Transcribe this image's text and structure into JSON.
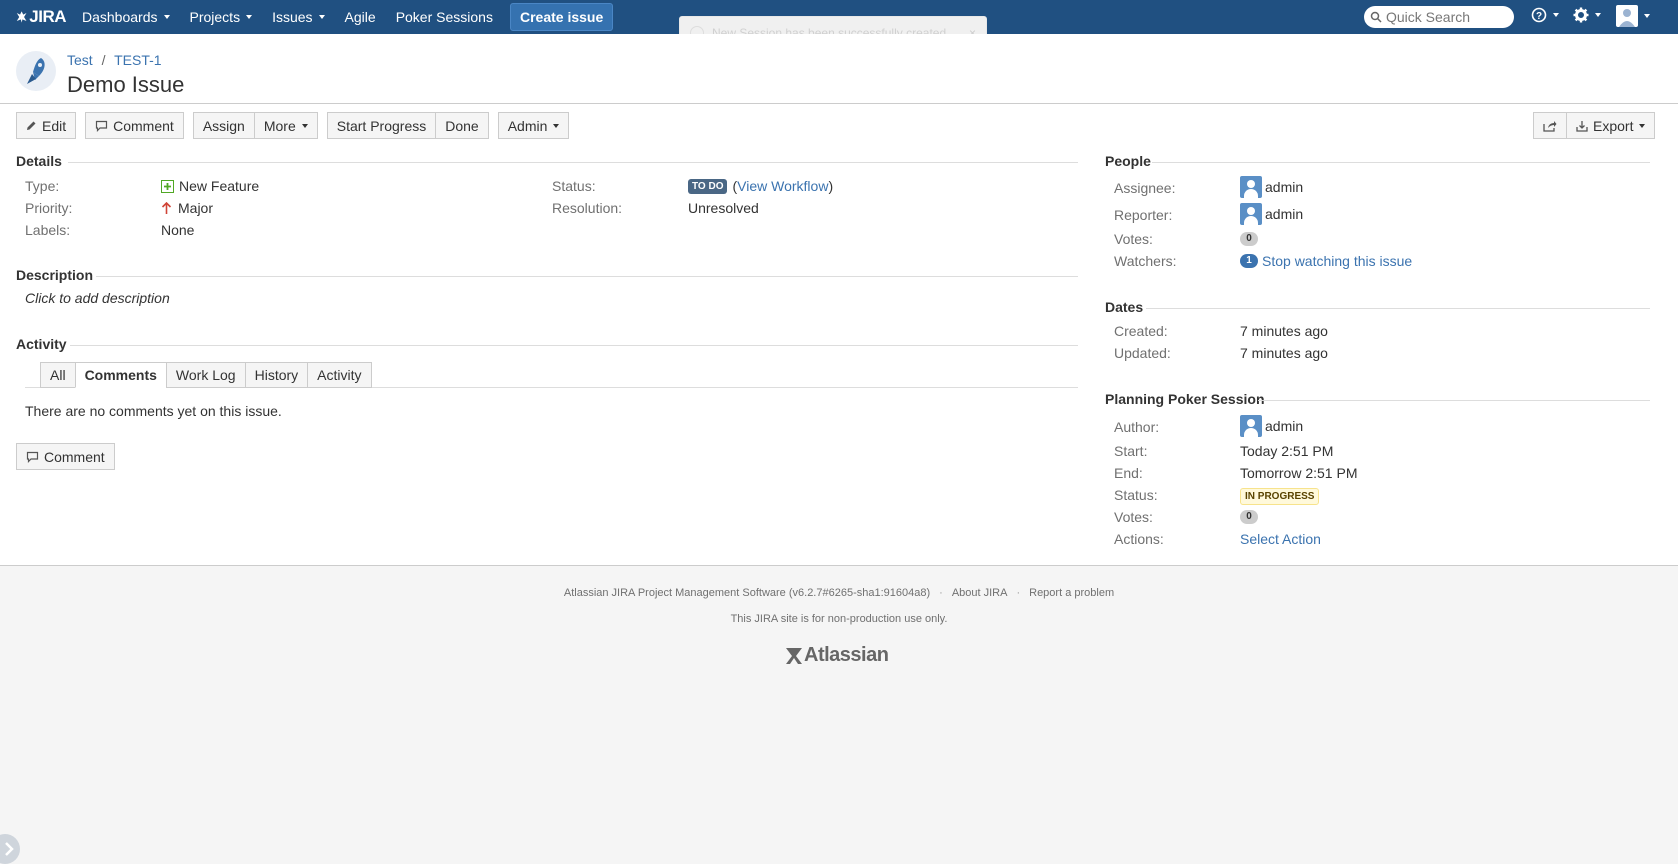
{
  "header": {
    "logo_text": "JIRA",
    "nav": [
      {
        "label": "Dashboards",
        "dropdown": true
      },
      {
        "label": "Projects",
        "dropdown": true
      },
      {
        "label": "Issues",
        "dropdown": true
      },
      {
        "label": "Agile",
        "dropdown": false
      },
      {
        "label": "Poker Sessions",
        "dropdown": false
      }
    ],
    "create_label": "Create issue",
    "search_placeholder": "Quick Search",
    "icons": [
      "help-icon",
      "gear-icon",
      "user-icon"
    ]
  },
  "toast": {
    "message": "New Session has been successfully created.",
    "close": "×"
  },
  "issue": {
    "project": "Test",
    "key": "TEST-1",
    "separator": "/",
    "title": "Demo Issue"
  },
  "toolbar": {
    "edit": "Edit",
    "comment": "Comment",
    "assign": "Assign",
    "more": "More",
    "start_progress": "Start Progress",
    "done": "Done",
    "admin": "Admin",
    "export": "Export"
  },
  "details": {
    "title": "Details",
    "type_label": "Type:",
    "type_value": "New Feature",
    "priority_label": "Priority:",
    "priority_value": "Major",
    "labels_label": "Labels:",
    "labels_value": "None",
    "status_label": "Status:",
    "status_value": "TO DO",
    "view_workflow": "View Workflow",
    "paren_open": "(",
    "paren_close": ")",
    "resolution_label": "Resolution:",
    "resolution_value": "Unresolved"
  },
  "description": {
    "title": "Description",
    "placeholder": "Click to add description"
  },
  "activity": {
    "title": "Activity",
    "tabs": [
      "All",
      "Comments",
      "Work Log",
      "History",
      "Activity"
    ],
    "active_tab": "Comments",
    "empty_text": "There are no comments yet on this issue.",
    "comment_button": "Comment"
  },
  "people": {
    "title": "People",
    "assignee_label": "Assignee:",
    "assignee": "admin",
    "reporter_label": "Reporter:",
    "reporter": "admin",
    "votes_label": "Votes:",
    "votes": "0",
    "watchers_label": "Watchers:",
    "watchers": "1",
    "stop_watching": "Stop watching this issue"
  },
  "dates": {
    "title": "Dates",
    "created_label": "Created:",
    "created": "7 minutes ago",
    "updated_label": "Updated:",
    "updated": "7 minutes ago"
  },
  "poker": {
    "title": "Planning Poker Session",
    "author_label": "Author:",
    "author": "admin",
    "start_label": "Start:",
    "start": "Today 2:51 PM",
    "end_label": "End:",
    "end": "Tomorrow 2:51 PM",
    "status_label": "Status:",
    "status": "IN PROGRESS",
    "votes_label": "Votes:",
    "votes": "0",
    "actions_label": "Actions:",
    "action": "Select Action"
  },
  "footer": {
    "software": "Atlassian JIRA Project Management Software (v6.2.7#6265-sha1:91604a8)",
    "about": "About JIRA",
    "report": "Report a problem",
    "note": "This JIRA site is for non-production use only.",
    "logo_text": "Atlassian",
    "dot": "·"
  },
  "colors": {
    "header_bg": "#205081",
    "link": "#3b73af",
    "todo_lozenge": "#4a6785",
    "in_progress_lozenge": "#fff9db"
  }
}
